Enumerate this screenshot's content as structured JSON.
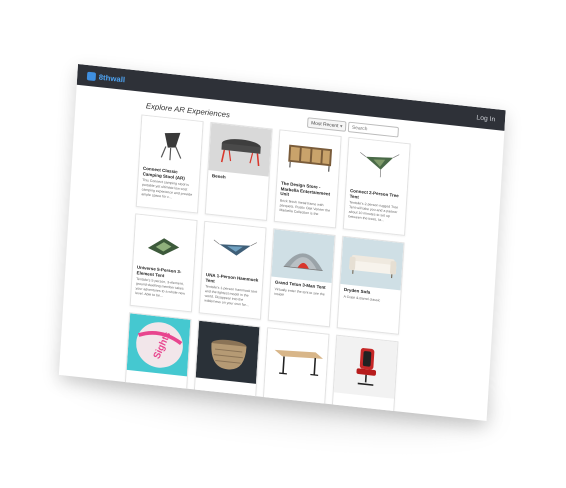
{
  "header": {
    "logo_text": "8thwall",
    "login_label": "Log In"
  },
  "page": {
    "title": "Explore AR Experiences",
    "sort_selected": "Most Recent",
    "search_placeholder": "Search"
  },
  "cards": [
    {
      "title": "Connect Classic Camping Stool (AR)",
      "desc": "This Connect camping stool is portable yet ultimate low-cost camping experience and provide ample space for c...",
      "image": "camping-stool"
    },
    {
      "title": "Bench",
      "desc": "",
      "image": "bench"
    },
    {
      "title": "The Design Store - Marbella Entertainment Unit",
      "desc": "Brick finish metal frame with parquets. Rustic Oak Veneer the Marbella Collection is the",
      "image": "entertainment-unit"
    },
    {
      "title": "Connect 2-Person Tree Tent",
      "desc": "Tentsile's 2-person rugged Tree Tent will take you and a partner about 10 minutes to set up between the trees, ta...",
      "image": "tree-tent"
    },
    {
      "title": "Universe 5-Person 3-Element Tent",
      "desc": "Tentsile's 5-person, 3-element, ground-dwelling member takes your adventures to a whole new level. Able to be...",
      "image": "ground-tent"
    },
    {
      "title": "UNA 1-Person Hammock Tent",
      "desc": "Tentsile's 1-person hammock tent and the lightest model in the world. Disappear into the wilderness on your own for...",
      "image": "hammock-tent"
    },
    {
      "title": "Grand Teton 3-Man Tent",
      "desc": "Virtually enter the tent to see the inside!",
      "image": "dome-tent"
    },
    {
      "title": "Dryden Sofa",
      "desc": "A Crate & Barrel classic",
      "image": "sofa"
    },
    {
      "title": "",
      "desc": "",
      "image": "beach-ball",
      "image_text": "Sights"
    },
    {
      "title": "",
      "desc": "",
      "image": "basket"
    },
    {
      "title": "",
      "desc": "",
      "image": "desk"
    },
    {
      "title": "",
      "desc": "",
      "image": "gaming-chair"
    }
  ],
  "colors": {
    "topbar": "#2e3138",
    "logo": "#4ea3f2",
    "accent_red": "#d9362b"
  }
}
